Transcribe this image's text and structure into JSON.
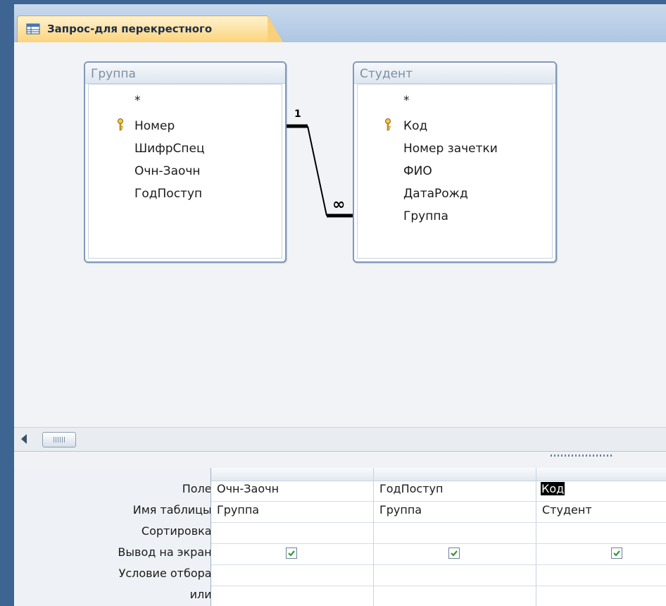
{
  "tab": {
    "title": "Запрос-для перекрестного",
    "icon": "query-icon"
  },
  "tables": [
    {
      "name": "Группа",
      "fields": [
        "*",
        "Номер",
        "ШифрСпец",
        "Очн-Заочн",
        "ГодПоступ"
      ],
      "key_field": "Номер"
    },
    {
      "name": "Студент",
      "fields": [
        "*",
        "Код",
        "Номер зачетки",
        "ФИО",
        "ДатаРожд",
        "Группа"
      ],
      "key_field": "Код"
    }
  ],
  "relationship": {
    "one_side": "1",
    "many_side": "∞"
  },
  "grid": {
    "row_labels": [
      "Поле:",
      "Имя таблицы:",
      "Сортировка:",
      "Вывод на экран:",
      "Условие отбора:",
      "или:"
    ],
    "columns": [
      {
        "field": "Очн-Заочн",
        "table": "Группа",
        "sort": "",
        "show": true,
        "criteria": "",
        "or": ""
      },
      {
        "field": "ГодПоступ",
        "table": "Группа",
        "sort": "",
        "show": true,
        "criteria": "",
        "or": ""
      },
      {
        "field": "Код",
        "table": "Студент",
        "sort": "",
        "show": true,
        "criteria": "",
        "or": "",
        "selected": true
      }
    ]
  },
  "colors": {
    "accent_tab": "#fbd47c",
    "frame": "#3e6591",
    "check": "#2f9a3a"
  }
}
